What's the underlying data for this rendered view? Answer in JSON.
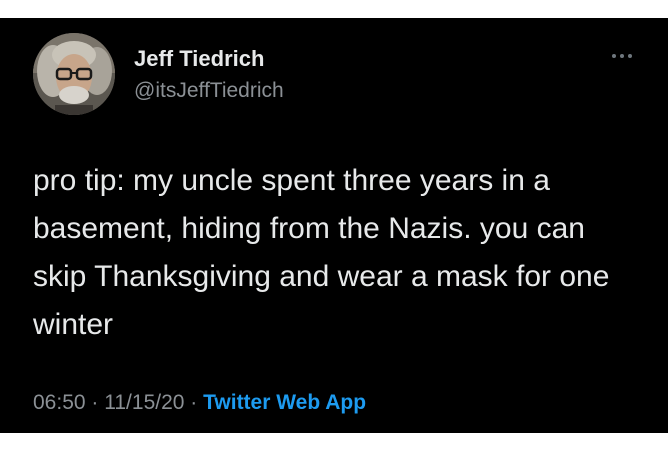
{
  "tweet": {
    "author": {
      "name": "Jeff Tiedrich",
      "handle": "@itsJeffTiedrich"
    },
    "text": "pro tip: my uncle spent three years in a basement, hiding from the Nazis. you can skip Thanksgiving and wear a mask for one winter",
    "time": "06:50",
    "separator": "·",
    "date": "11/15/20",
    "source": "Twitter Web App",
    "more_icon": "more-horizontal-icon"
  },
  "colors": {
    "background": "#000000",
    "text": "#e7e9ea",
    "muted": "#8b9095",
    "link": "#1d9bf0"
  }
}
